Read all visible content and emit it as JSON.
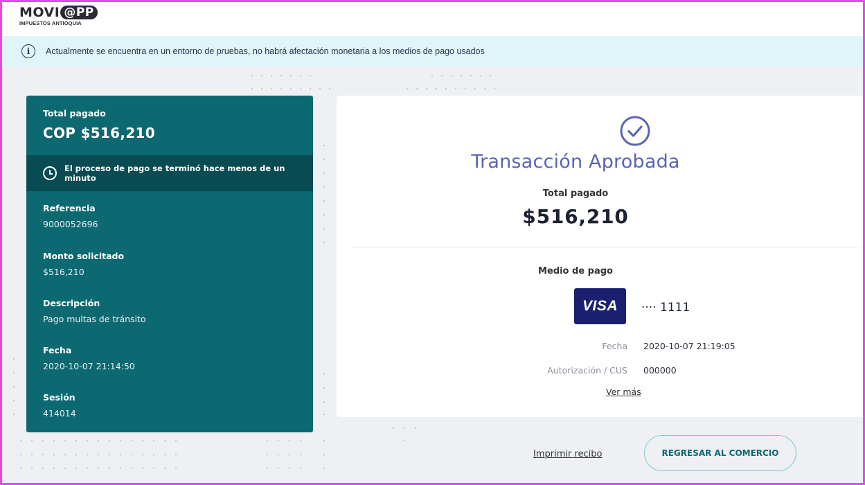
{
  "header": {
    "logo_main": "MOVI",
    "logo_pill": "@PP",
    "logo_sub": "IMPUESTOS ANTIOQUIA"
  },
  "banner": {
    "icon": "info-icon",
    "text": "Actualmente se encuentra en un entorno de pruebas, no habrá afectación monetaria a los medios de pago usados"
  },
  "summary": {
    "total_label": "Total pagado",
    "total_value": "COP $516,210",
    "process_text": "El proceso de pago se terminó hace menos de un minuto",
    "fields": [
      {
        "label": "Referencia",
        "value": "9000052696"
      },
      {
        "label": "Monto solicitado",
        "value": "$516,210"
      },
      {
        "label": "Descripción",
        "value": "Pago multas de tránsito"
      },
      {
        "label": "Fecha",
        "value": "2020-10-07 21:14:50"
      },
      {
        "label": "Sesión",
        "value": "414014"
      }
    ]
  },
  "result": {
    "title": "Transacción Aprobada",
    "total_label": "Total pagado",
    "total_value": "$516,210",
    "payment_method_label": "Medio de pago",
    "card_brand": "VISA",
    "card_number": "···· 1111",
    "details": [
      {
        "label": "Fecha",
        "value": "2020-10-07 21:19:05"
      },
      {
        "label": "Autorización / CUS",
        "value": "000000"
      }
    ],
    "more_link": "Ver más"
  },
  "actions": {
    "print_label": "Imprimir recibo",
    "return_label": "REGRESAR AL COMERCIO"
  },
  "colors": {
    "teal": "#0c6871",
    "teal_dark": "#094b52",
    "accent_purple": "#5a64b3",
    "visa_blue": "#1a1f71",
    "banner_bg": "#dff5f8"
  }
}
